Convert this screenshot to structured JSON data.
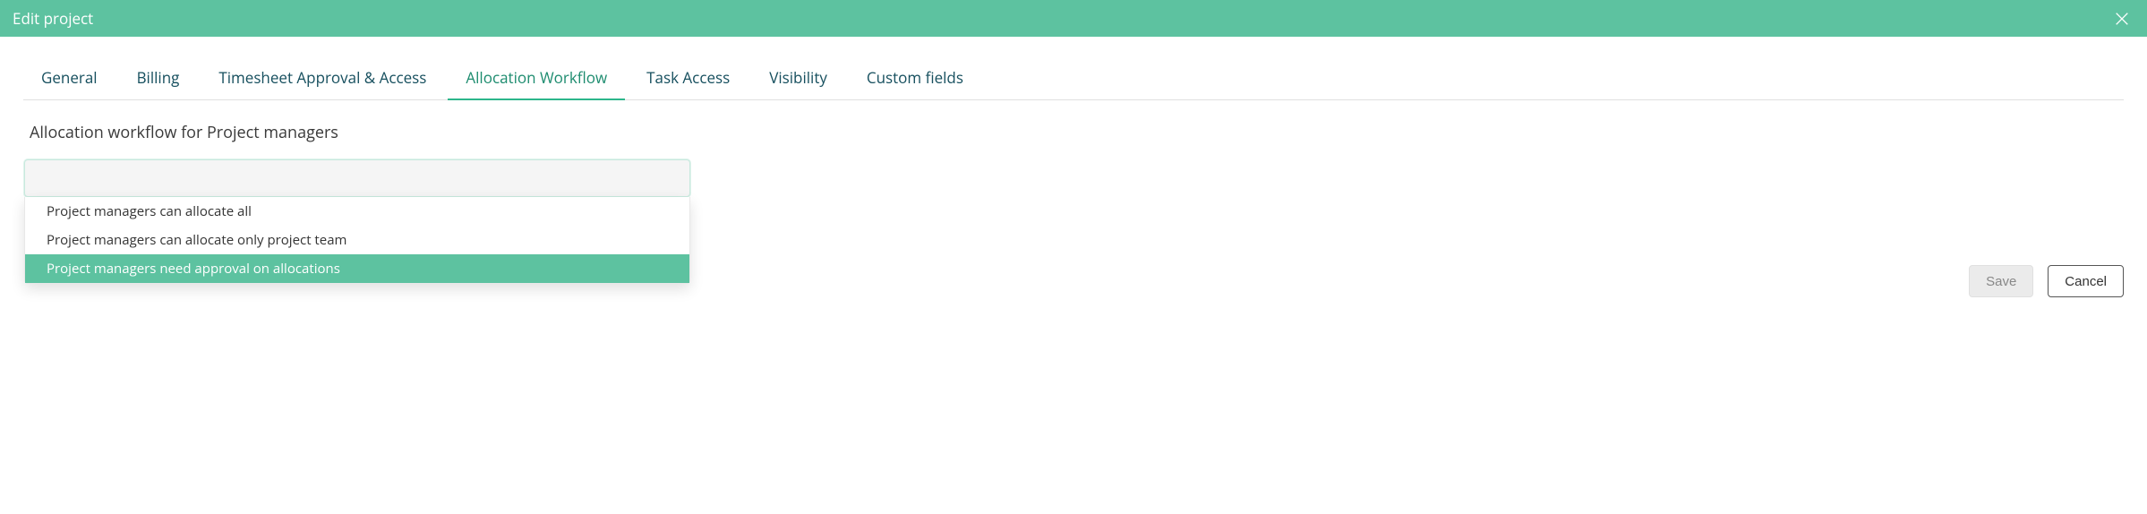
{
  "header": {
    "title": "Edit project"
  },
  "tabs": {
    "items": [
      {
        "label": "General",
        "active": false
      },
      {
        "label": "Billing",
        "active": false
      },
      {
        "label": "Timesheet Approval & Access",
        "active": false
      },
      {
        "label": "Allocation Workflow",
        "active": true
      },
      {
        "label": "Task Access",
        "active": false
      },
      {
        "label": "Visibility",
        "active": false
      },
      {
        "label": "Custom fields",
        "active": false
      }
    ]
  },
  "section": {
    "title": "Allocation workflow for Project managers"
  },
  "dropdown": {
    "value": "",
    "options": [
      {
        "label": "Project managers can allocate all",
        "selected": false
      },
      {
        "label": "Project managers can allocate only project team",
        "selected": false
      },
      {
        "label": "Project managers need approval on allocations",
        "selected": true
      }
    ]
  },
  "footer": {
    "save_label": "Save",
    "cancel_label": "Cancel"
  }
}
